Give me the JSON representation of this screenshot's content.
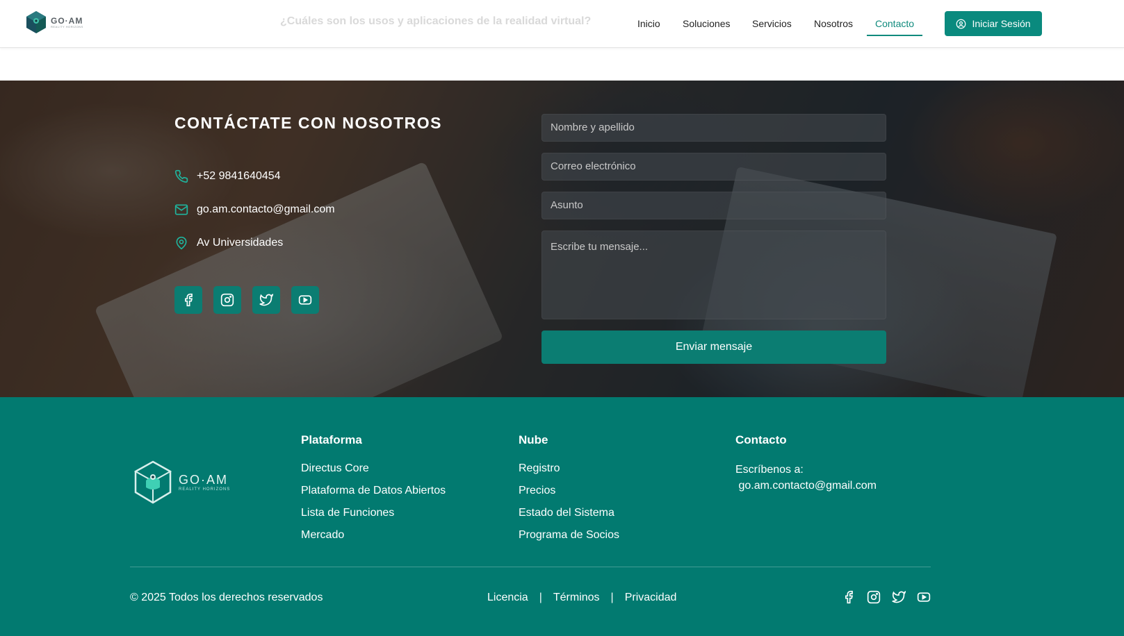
{
  "header": {
    "logo_text": "GO·AM",
    "logo_subtext": "REALITY HORIZONS",
    "faded_title": "¿Cuáles son los usos y aplicaciones de la realidad virtual?",
    "nav": [
      {
        "label": "Inicio",
        "active": false
      },
      {
        "label": "Soluciones",
        "active": false
      },
      {
        "label": "Servicios",
        "active": false
      },
      {
        "label": "Nosotros",
        "active": false
      },
      {
        "label": "Contacto",
        "active": true
      }
    ],
    "login_label": "Iniciar Sesión",
    "login_icon": "user-circle-icon"
  },
  "contact": {
    "title": "CONTÁCTATE CON NOSOTROS",
    "phone": "+52 9841640454",
    "email": "go.am.contacto@gmail.com",
    "address": "Av Universidades",
    "socials": [
      "facebook-icon",
      "instagram-icon",
      "twitter-icon",
      "youtube-icon"
    ],
    "form": {
      "name_placeholder": "Nombre y apellido",
      "email_placeholder": "Correo electrónico",
      "subject_placeholder": "Asunto",
      "message_placeholder": "Escribe tu mensaje...",
      "submit_label": "Enviar mensaje"
    }
  },
  "footer": {
    "logo_text": "GO·AM",
    "logo_subtext": "REALITY HORIZONS",
    "columns": [
      {
        "title": "Plataforma",
        "links": [
          "Directus Core",
          "Plataforma de Datos Abiertos",
          "Lista de Funciones",
          "Mercado"
        ]
      },
      {
        "title": "Nube",
        "links": [
          "Registro",
          "Precios",
          "Estado del Sistema",
          "Programa de Socios"
        ]
      }
    ],
    "contact_col": {
      "title": "Contacto",
      "line1": "Escríbenos a:",
      "line2": " go.am.contacto@gmail.com"
    },
    "copyright": "© 2025 Todos los derechos reservados",
    "legal": [
      "Licencia",
      "Términos",
      "Privacidad"
    ],
    "legal_sep": "|"
  },
  "colors": {
    "accent": "#0b7d72",
    "footer_bg": "#027a70",
    "nav_active": "#0f8a7d"
  }
}
